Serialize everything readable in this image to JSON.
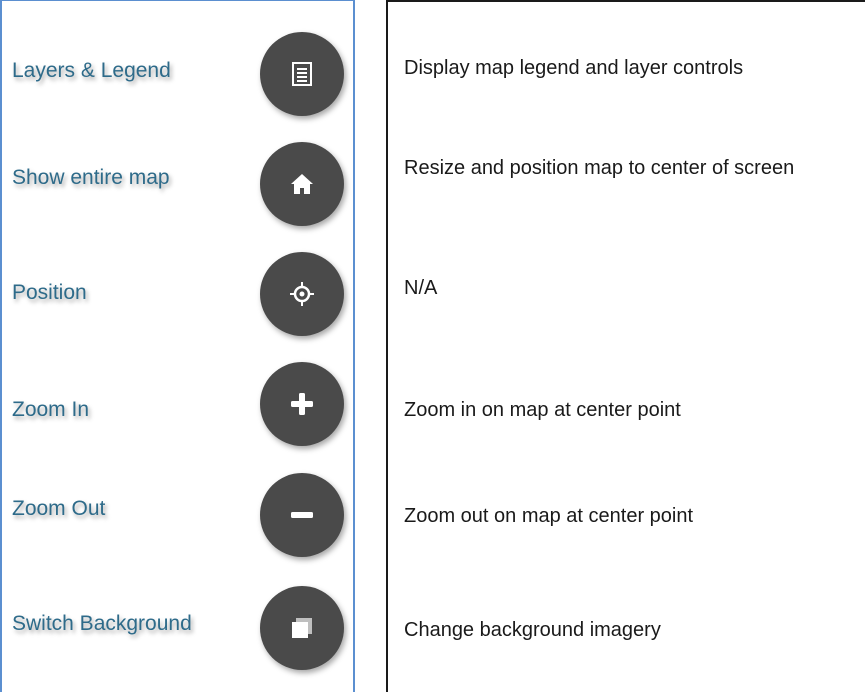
{
  "tools": [
    {
      "label": "Layers & Legend",
      "icon": "legend-list-icon",
      "description": "Display map legend and layer controls"
    },
    {
      "label": "Show entire map",
      "icon": "home-icon",
      "description": "Resize and position map to center of screen"
    },
    {
      "label": "Position",
      "icon": "crosshair-icon",
      "description": "N/A"
    },
    {
      "label": "Zoom In",
      "icon": "plus-icon",
      "description": "Zoom in on map at center point"
    },
    {
      "label": "Zoom Out",
      "icon": "minus-icon",
      "description": "Zoom out on map at center point"
    },
    {
      "label": "Switch Background",
      "icon": "layers-stack-icon",
      "description": "Change background imagery"
    }
  ],
  "colors": {
    "label_text": "#2e6b8a",
    "button_bg": "#4a4a4a",
    "icon_fg": "#ffffff",
    "left_border": "#5b8fd0",
    "right_border": "#1a1a1a"
  }
}
